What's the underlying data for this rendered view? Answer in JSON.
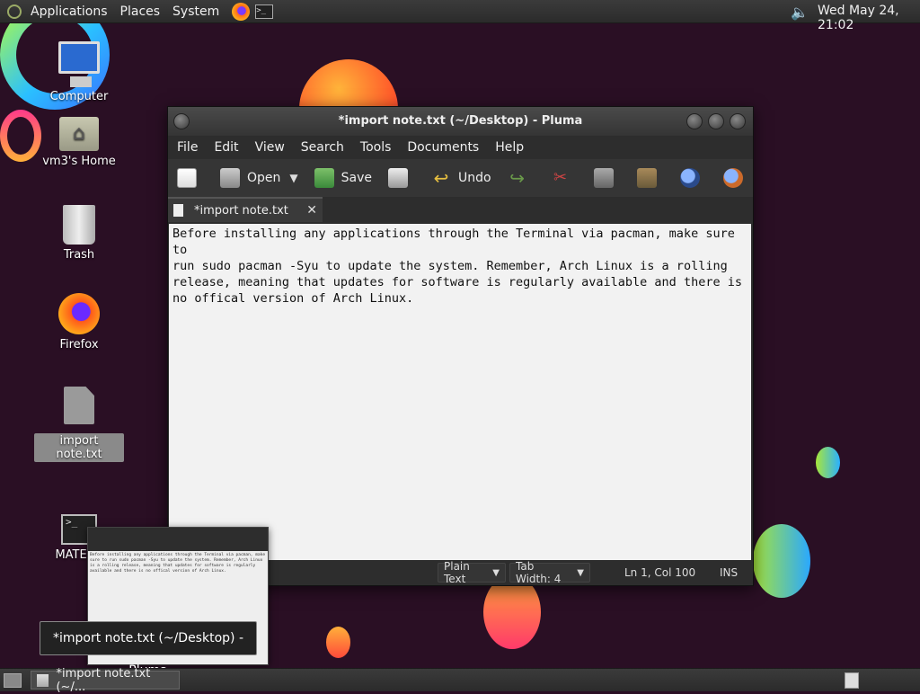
{
  "top_panel": {
    "menus": [
      "Applications",
      "Places",
      "System"
    ],
    "clock": "Wed May 24, 21:02"
  },
  "desktop_icons": [
    {
      "label": "Computer"
    },
    {
      "label": "vm3's Home"
    },
    {
      "label": "Trash"
    },
    {
      "label": "Firefox"
    },
    {
      "label": "import note.txt"
    },
    {
      "label": "MATE Te"
    }
  ],
  "window": {
    "title": "*import note.txt (~/Desktop) - Pluma",
    "menus": [
      "File",
      "Edit",
      "View",
      "Search",
      "Tools",
      "Documents",
      "Help"
    ],
    "toolbar": {
      "open_label": "Open",
      "save_label": "Save",
      "undo_label": "Undo"
    },
    "tab_label": "*import note.txt",
    "editor_text": "Before installing any applications through the Terminal via pacman, make sure to\nrun sudo pacman -Syu to update the system. Remember, Arch Linux is a rolling\nrelease, meaning that updates for software is regularly available and there is\nno offical version of Arch Linux.",
    "status": {
      "language": "Plain Text",
      "tab_width": "Tab Width:  4",
      "position": "Ln 1, Col 100",
      "mode": "INS"
    }
  },
  "tooltip": "*import note.txt (~/Desktop) - Pluma",
  "taskbar": {
    "task_label": "*import note.txt (~/..."
  }
}
